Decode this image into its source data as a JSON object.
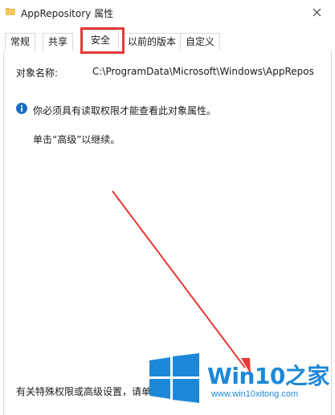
{
  "window": {
    "title": "AppRepository 属性"
  },
  "tabs": [
    {
      "label": "常规"
    },
    {
      "label": "共享"
    },
    {
      "label": "安全"
    },
    {
      "label": "以前的版本"
    },
    {
      "label": "自定义"
    }
  ],
  "security": {
    "object_name_label": "对象名称:",
    "object_name_value": "C:\\ProgramData\\Microsoft\\Windows\\AppRepos",
    "info_message": "你必须具有读取权限才能查看此对象属性。",
    "click_message": "单击“高级”以继续。",
    "bottom_message": "有关特殊权限或高级设置，请单"
  },
  "annotation": {
    "highlight_color": "#e53935"
  },
  "watermark": {
    "brand": "Win10",
    "zhi": "之家",
    "url": "www.win10xitong.com",
    "accent": "#1e88d8"
  }
}
